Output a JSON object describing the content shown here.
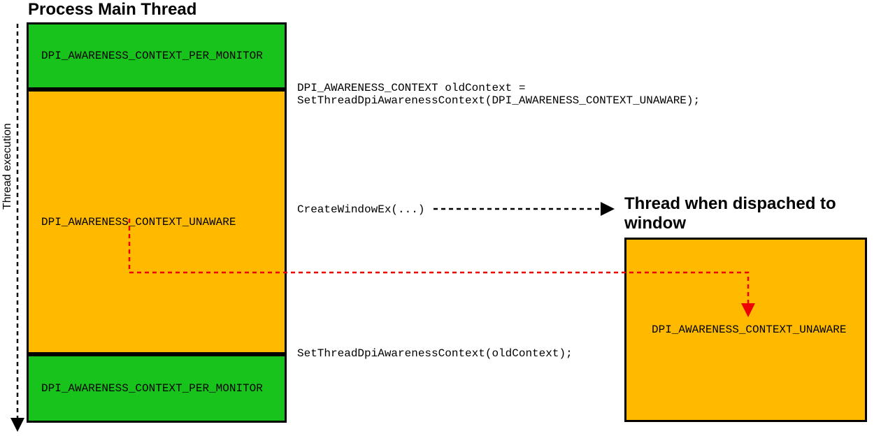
{
  "titles": {
    "left": "Process Main Thread",
    "right": "Thread when dispached to window"
  },
  "blocks": {
    "top_green": "DPI_AWARENESS_CONTEXT_PER_MONITOR",
    "middle_orange": "DPI_AWARENESS_CONTEXT_UNAWARE",
    "bottom_green": "DPI_AWARENESS_CONTEXT_PER_MONITOR",
    "right_orange": "DPI_AWARENESS_CONTEXT_UNAWARE"
  },
  "annotations": {
    "set1": "DPI_AWARENESS_CONTEXT oldContext =\nSetThreadDpiAwarenessContext(DPI_AWARENESS_CONTEXT_UNAWARE);",
    "create": "CreateWindowEx(...)",
    "set2": "SetThreadDpiAwarenessContext(oldContext);"
  },
  "axis_label": "Thread execution",
  "colors": {
    "green": "#18c41c",
    "orange": "#ffba00",
    "red": "#ee0000"
  }
}
